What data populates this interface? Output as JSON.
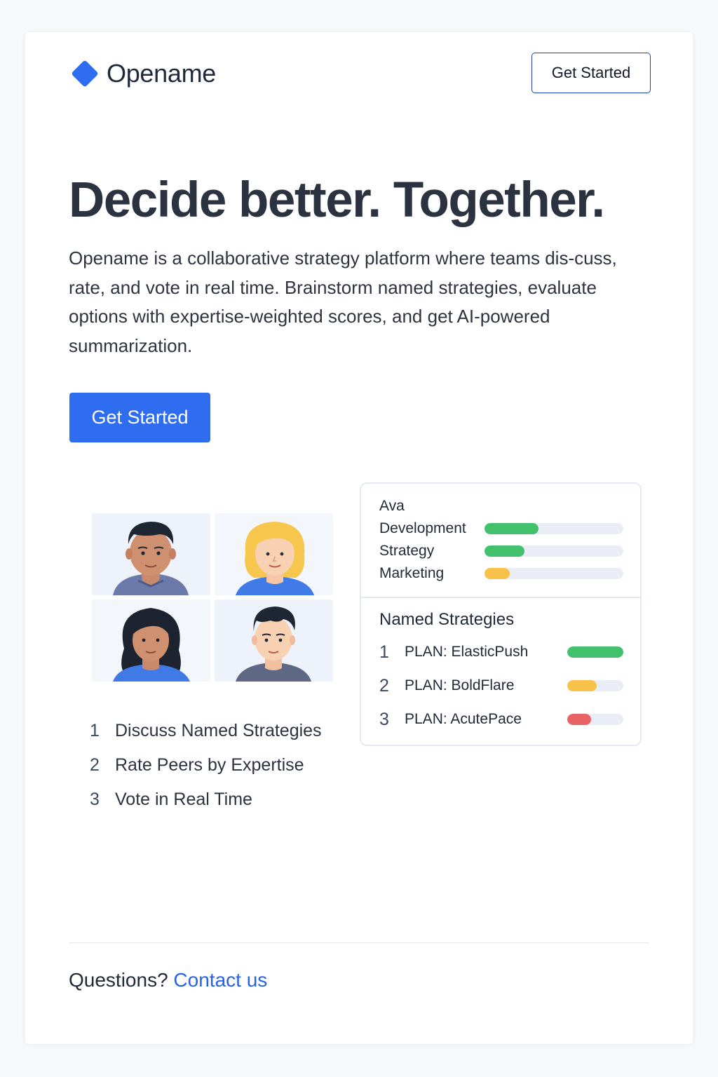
{
  "brand": {
    "name": "Opename",
    "accent": "#2f6df0"
  },
  "header": {
    "cta_label": "Get Started"
  },
  "hero": {
    "title": "Decide better. Together.",
    "brand_word": "Opename",
    "description_rest": " is a collaborative strategy platform where teams dis-cuss, rate, and vote in real time. Brainstorm named strategies, evaluate options with expertise-weighted scores, and get AI-powered summarization.",
    "cta_label": "Get Started"
  },
  "avatars": [
    {
      "name": "avatar-man-dark-hair",
      "icon": "person-icon"
    },
    {
      "name": "avatar-woman-blonde",
      "icon": "person-icon"
    },
    {
      "name": "avatar-woman-long-hair",
      "icon": "person-icon"
    },
    {
      "name": "avatar-man-short-hair",
      "icon": "person-icon"
    }
  ],
  "steps": [
    {
      "num": "1",
      "label": "Discuss Named Strategies"
    },
    {
      "num": "2",
      "label": "Rate Peers by Expertise"
    },
    {
      "num": "3",
      "label": "Vote in Real Time"
    }
  ],
  "panel": {
    "person": "Ava",
    "skills": [
      {
        "label": "Development",
        "value": 0.39,
        "color": "#43c06b"
      },
      {
        "label": "Strategy",
        "value": 0.29,
        "color": "#43c06b"
      },
      {
        "label": "Marketing",
        "value": 0.18,
        "color": "#f8c14a"
      }
    ],
    "heading": "Named Strategies",
    "strategies": [
      {
        "num": "1",
        "name": "PLAN: ElasticPush",
        "value": 1.0,
        "color": "#43c06b"
      },
      {
        "num": "2",
        "name": "PLAN: BoldFlare",
        "value": 0.52,
        "color": "#f8c14a"
      },
      {
        "num": "3",
        "name": "PLAN: AcutePace",
        "value": 0.42,
        "color": "#e86464"
      }
    ]
  },
  "footer": {
    "question": "Questions?",
    "link_label": "Contact us"
  }
}
